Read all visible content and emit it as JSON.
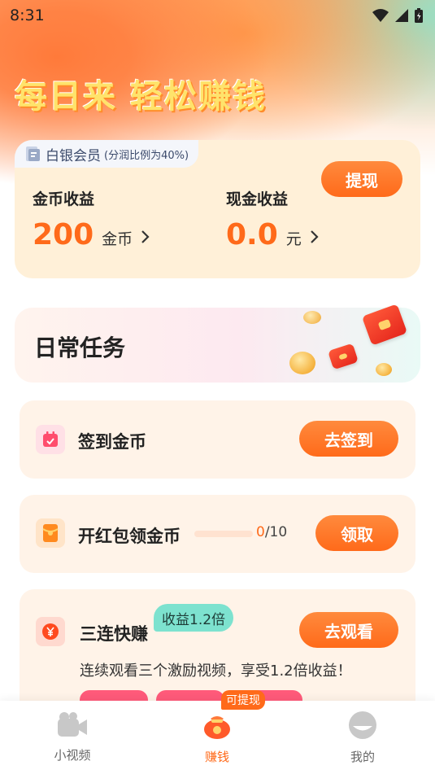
{
  "status_bar": {
    "time": "8:31"
  },
  "hero": {
    "title": "每日来 轻松赚钱"
  },
  "member": {
    "level": "白银会员",
    "ratio_note": "(分润比例为40%)",
    "coin_label": "金币收益",
    "coin_value": "200",
    "coin_unit": "金币",
    "cash_label": "现金收益",
    "cash_value": "0.0",
    "cash_unit": "元",
    "withdraw_label": "提现"
  },
  "daily": {
    "title": "日常任务"
  },
  "tasks": [
    {
      "name": "签到金币",
      "button": "去签到",
      "icon": "calendar-check-icon"
    },
    {
      "name": "开红包领金币",
      "button": "领取",
      "icon": "red-envelope-icon",
      "progress_current": "0",
      "progress_total": "/10",
      "progress_fraction": 0
    },
    {
      "name": "三连快赚",
      "button": "去观看",
      "icon": "yuan-coin-icon",
      "tag": "收益1.2倍",
      "description": "连续观看三个激励视频，享受1.2倍收益！"
    }
  ],
  "tab_bar": {
    "items": [
      {
        "label": "小视频",
        "icon": "video-icon"
      },
      {
        "label": "赚钱",
        "icon": "money-bag-icon",
        "badge": "可提现"
      },
      {
        "label": "我的",
        "icon": "profile-icon"
      }
    ]
  },
  "colors": {
    "accent": "#ff6a1a",
    "card_bg": "#fff0d8",
    "task_bg": "#fff3e8",
    "mint": "#7de2cf",
    "pink": "#ff5a7a"
  }
}
